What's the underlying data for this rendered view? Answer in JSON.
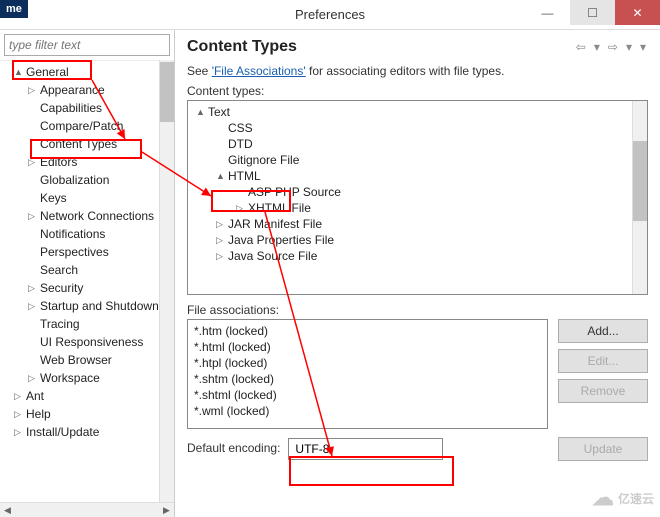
{
  "window": {
    "title": "Preferences",
    "badge": "me"
  },
  "sidebar": {
    "filter_placeholder": "type filter text",
    "items": [
      {
        "label": "General",
        "level": 1,
        "exp": "▲"
      },
      {
        "label": "Appearance",
        "level": 2,
        "exp": "▷"
      },
      {
        "label": "Capabilities",
        "level": 2
      },
      {
        "label": "Compare/Patch",
        "level": 2
      },
      {
        "label": "Content Types",
        "level": 2
      },
      {
        "label": "Editors",
        "level": 2,
        "exp": "▷"
      },
      {
        "label": "Globalization",
        "level": 2
      },
      {
        "label": "Keys",
        "level": 2
      },
      {
        "label": "Network Connections",
        "level": 2,
        "exp": "▷"
      },
      {
        "label": "Notifications",
        "level": 2
      },
      {
        "label": "Perspectives",
        "level": 2
      },
      {
        "label": "Search",
        "level": 2
      },
      {
        "label": "Security",
        "level": 2,
        "exp": "▷"
      },
      {
        "label": "Startup and Shutdown",
        "level": 2,
        "exp": "▷"
      },
      {
        "label": "Tracing",
        "level": 2
      },
      {
        "label": "UI Responsiveness",
        "level": 2
      },
      {
        "label": "Web Browser",
        "level": 2
      },
      {
        "label": "Workspace",
        "level": 2,
        "exp": "▷"
      },
      {
        "label": "Ant",
        "level": 1,
        "exp": "▷"
      },
      {
        "label": "Help",
        "level": 1,
        "exp": "▷"
      },
      {
        "label": "Install/Update",
        "level": 1,
        "exp": "▷"
      }
    ]
  },
  "content": {
    "title": "Content Types",
    "desc_prefix": "See ",
    "desc_link": "'File Associations'",
    "desc_suffix": " for associating editors with file types.",
    "ct_label": "Content types:",
    "ct_tree": [
      {
        "label": "Text",
        "level": 1,
        "exp": "▲"
      },
      {
        "label": "CSS",
        "level": 2
      },
      {
        "label": "DTD",
        "level": 2
      },
      {
        "label": "Gitignore File",
        "level": 2
      },
      {
        "label": "HTML",
        "level": 2,
        "exp": "▲"
      },
      {
        "label": "ASP PHP Source",
        "level": 3
      },
      {
        "label": "XHTML File",
        "level": 3,
        "exp": "▷"
      },
      {
        "label": "JAR Manifest File",
        "level": 2,
        "exp": "▷"
      },
      {
        "label": "Java Properties File",
        "level": 2,
        "exp": "▷"
      },
      {
        "label": "Java Source File",
        "level": 2,
        "exp": "▷"
      }
    ],
    "fa_label": "File associations:",
    "fa_items": [
      "*.htm (locked)",
      "*.html (locked)",
      "*.htpl (locked)",
      "*.shtm (locked)",
      "*.shtml (locked)",
      "*.wml (locked)"
    ],
    "buttons": {
      "add": "Add...",
      "edit": "Edit...",
      "remove": "Remove",
      "update": "Update"
    },
    "enc_label": "Default encoding:",
    "enc_value": "UTF-8"
  },
  "watermark": "亿速云"
}
